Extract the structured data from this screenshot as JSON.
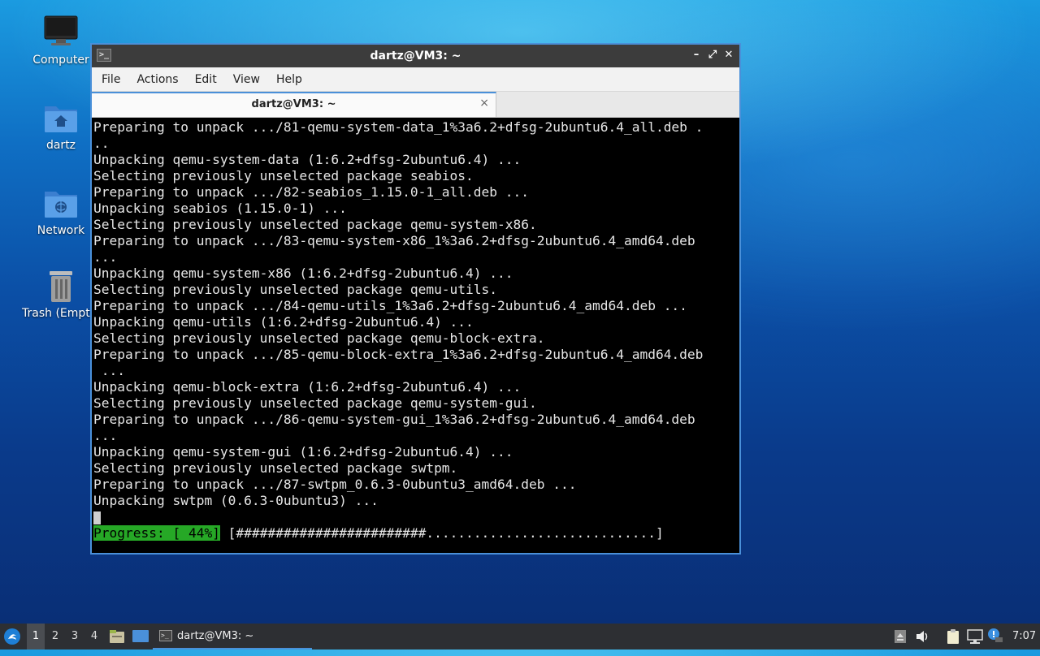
{
  "desktop": {
    "icons": [
      {
        "label": "Computer"
      },
      {
        "label": "dartz"
      },
      {
        "label": "Network"
      },
      {
        "label": "Trash (Empty)"
      }
    ]
  },
  "window": {
    "title": "dartz@VM3: ~",
    "menu": [
      "File",
      "Actions",
      "Edit",
      "View",
      "Help"
    ],
    "tab_label": "dartz@VM3: ~",
    "close_glyph": "×",
    "minimize_glyph": "–",
    "maximize_glyph": "⤢",
    "window_close_glyph": "✕"
  },
  "terminal": {
    "lines": [
      "Preparing to unpack .../81-qemu-system-data_1%3a6.2+dfsg-2ubuntu6.4_all.deb .",
      "..",
      "Unpacking qemu-system-data (1:6.2+dfsg-2ubuntu6.4) ...",
      "Selecting previously unselected package seabios.",
      "Preparing to unpack .../82-seabios_1.15.0-1_all.deb ...",
      "Unpacking seabios (1.15.0-1) ...",
      "Selecting previously unselected package qemu-system-x86.",
      "Preparing to unpack .../83-qemu-system-x86_1%3a6.2+dfsg-2ubuntu6.4_amd64.deb",
      "...",
      "Unpacking qemu-system-x86 (1:6.2+dfsg-2ubuntu6.4) ...",
      "Selecting previously unselected package qemu-utils.",
      "Preparing to unpack .../84-qemu-utils_1%3a6.2+dfsg-2ubuntu6.4_amd64.deb ...",
      "Unpacking qemu-utils (1:6.2+dfsg-2ubuntu6.4) ...",
      "Selecting previously unselected package qemu-block-extra.",
      "Preparing to unpack .../85-qemu-block-extra_1%3a6.2+dfsg-2ubuntu6.4_amd64.deb",
      " ...",
      "Unpacking qemu-block-extra (1:6.2+dfsg-2ubuntu6.4) ...",
      "Selecting previously unselected package qemu-system-gui.",
      "Preparing to unpack .../86-qemu-system-gui_1%3a6.2+dfsg-2ubuntu6.4_amd64.deb",
      "...",
      "Unpacking qemu-system-gui (1:6.2+dfsg-2ubuntu6.4) ...",
      "Selecting previously unselected package swtpm.",
      "Preparing to unpack .../87-swtpm_0.6.3-0ubuntu3_amd64.deb ...",
      "Unpacking swtpm (0.6.3-0ubuntu3) ..."
    ],
    "progress_label": "Progress: [ 44%]",
    "progress_bar": " [########################.............................]",
    "progress_percent": 44,
    "progress_color": "#26a826"
  },
  "taskbar": {
    "workspaces": [
      "1",
      "2",
      "3",
      "4"
    ],
    "active_workspace": "1",
    "task_label": "dartz@VM3: ~",
    "clock": "7:07",
    "start_icon": "lubuntu-logo-icon",
    "tray_icons": [
      "eject-icon",
      "volume-icon",
      "clipboard-icon",
      "network-icon",
      "update-notifier-icon"
    ]
  },
  "colors": {
    "accent": "#4a90d9",
    "titlebar": "#3c3c3c",
    "taskbar": "#2d2f33"
  }
}
